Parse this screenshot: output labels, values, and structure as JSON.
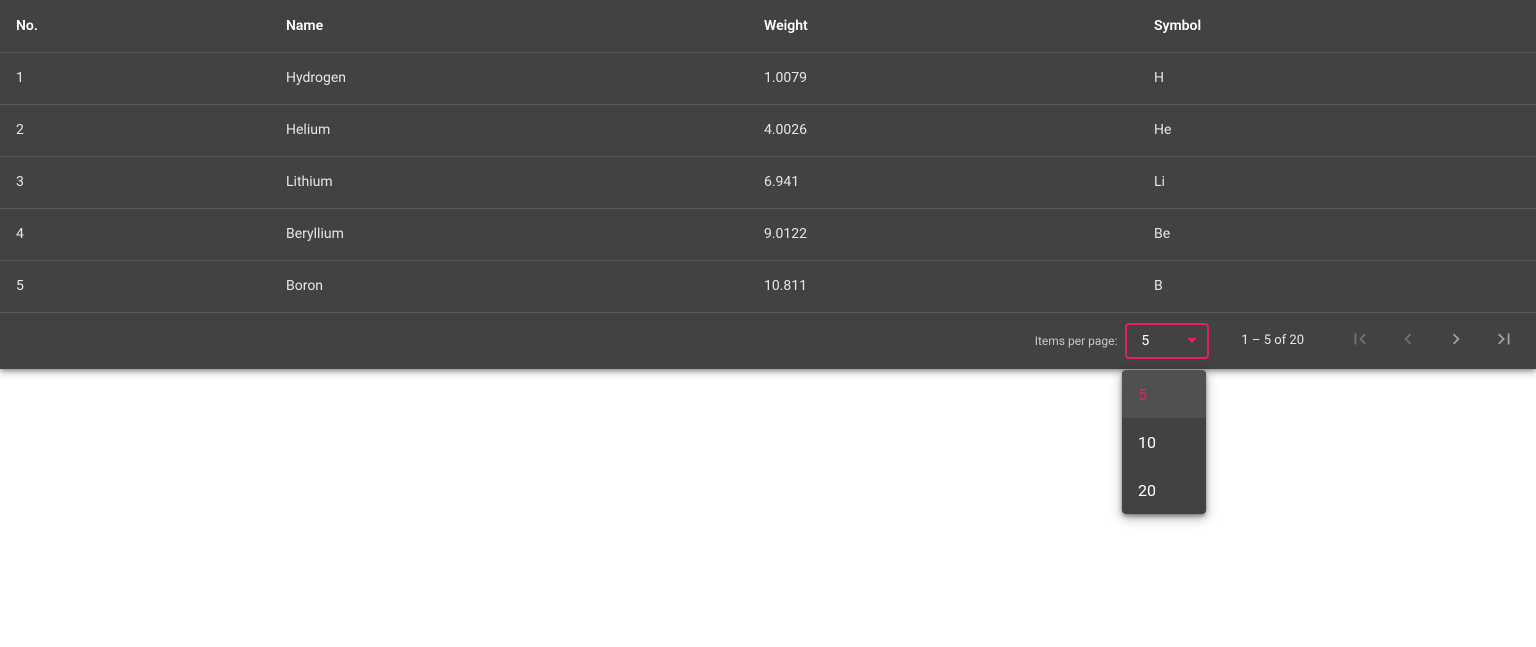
{
  "table": {
    "columns": [
      "No.",
      "Name",
      "Weight",
      "Symbol"
    ],
    "rows": [
      {
        "no": "1",
        "name": "Hydrogen",
        "weight": "1.0079",
        "symbol": "H"
      },
      {
        "no": "2",
        "name": "Helium",
        "weight": "4.0026",
        "symbol": "He"
      },
      {
        "no": "3",
        "name": "Lithium",
        "weight": "6.941",
        "symbol": "Li"
      },
      {
        "no": "4",
        "name": "Beryllium",
        "weight": "9.0122",
        "symbol": "Be"
      },
      {
        "no": "5",
        "name": "Boron",
        "weight": "10.811",
        "symbol": "B"
      }
    ]
  },
  "paginator": {
    "items_per_page_label": "Items per page:",
    "page_size": "5",
    "range_label": "1 – 5 of 20",
    "options": [
      "5",
      "10",
      "20"
    ]
  },
  "colors": {
    "surface": "#424242",
    "accent": "#e91e63"
  }
}
